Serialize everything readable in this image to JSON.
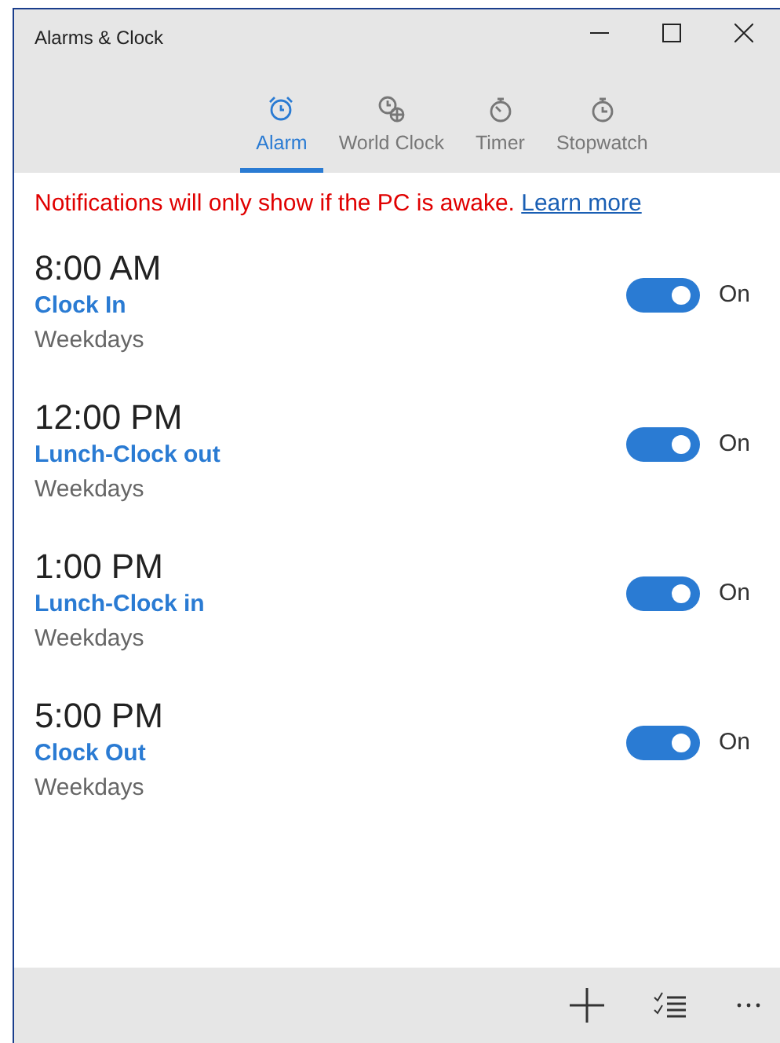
{
  "window": {
    "title": "Alarms & Clock"
  },
  "tabs": [
    {
      "label": "Alarm",
      "kind": "alarm",
      "selected": true
    },
    {
      "label": "World Clock",
      "kind": "world",
      "selected": false
    },
    {
      "label": "Timer",
      "kind": "timer",
      "selected": false
    },
    {
      "label": "Stopwatch",
      "kind": "stopwatch",
      "selected": false
    }
  ],
  "notice": {
    "text": "Notifications will only show if the PC is awake.",
    "link": "Learn more"
  },
  "alarms": [
    {
      "time": "8:00 AM",
      "name": "Clock In",
      "repeat": "Weekdays",
      "on": true,
      "state_label": "On"
    },
    {
      "time": "12:00 PM",
      "name": "Lunch-Clock out",
      "repeat": "Weekdays",
      "on": true,
      "state_label": "On"
    },
    {
      "time": "1:00 PM",
      "name": "Lunch-Clock in",
      "repeat": "Weekdays",
      "on": true,
      "state_label": "On"
    },
    {
      "time": "5:00 PM",
      "name": "Clock Out",
      "repeat": "Weekdays",
      "on": true,
      "state_label": "On"
    }
  ]
}
